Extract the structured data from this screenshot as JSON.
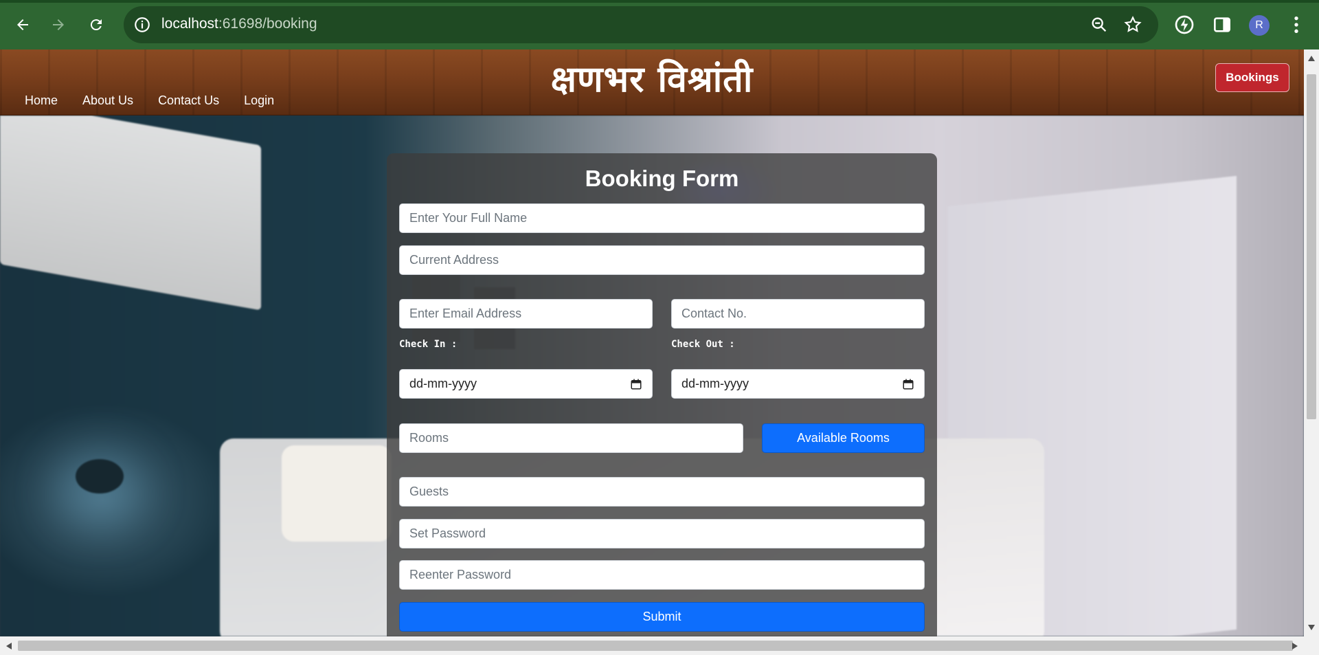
{
  "browser": {
    "url_host": "localhost",
    "url_path": ":61698/booking",
    "profile_initial": "R"
  },
  "site": {
    "brand": "क्षणभर विश्रांती",
    "nav": [
      "Home",
      "About Us",
      "Contact Us",
      "Login"
    ],
    "bookings_label": "Bookings"
  },
  "form": {
    "title": "Booking Form",
    "full_name_placeholder": "Enter Your Full Name",
    "address_placeholder": "Current Address",
    "email_placeholder": "Enter Email Address",
    "contact_placeholder": "Contact No.",
    "check_in_label": "Check In :",
    "check_out_label": "Check Out :",
    "check_in_value": "dd-mm-yyyy",
    "check_out_value": "dd-mm-yyyy",
    "rooms_placeholder": "Rooms",
    "available_rooms_label": "Available Rooms",
    "guests_placeholder": "Guests",
    "set_password_placeholder": "Set Password",
    "reenter_password_placeholder": "Reenter Password",
    "submit_label": "Submit"
  },
  "colors": {
    "chrome": "#2e6632",
    "primary_button": "#0d6efd",
    "bookings_button": "#c0262d"
  }
}
